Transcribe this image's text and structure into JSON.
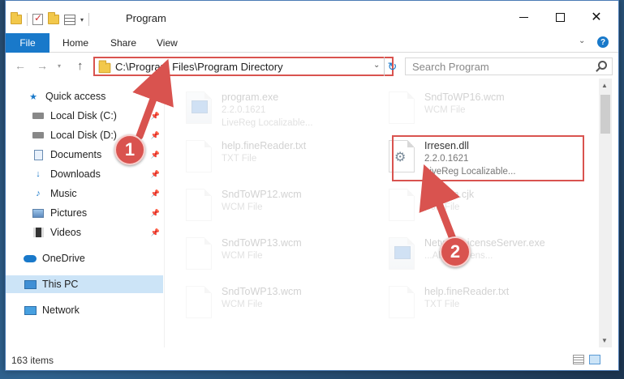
{
  "window": {
    "title": "Program",
    "controls": {
      "minimize": "",
      "maximize": "",
      "close": "✕"
    }
  },
  "ribbon": {
    "tabs": [
      "File",
      "Home",
      "Share",
      "View"
    ],
    "help": "?"
  },
  "navigation": {
    "back": "←",
    "forward": "→",
    "recent": "▾",
    "up": "↑",
    "address": "C:\\Program Files\\Program Directory",
    "refresh": "↻",
    "search_placeholder": "Search Program"
  },
  "sidebar": {
    "items": [
      {
        "label": "Quick access",
        "icon": "star-icon",
        "pinned": false
      },
      {
        "label": "Local Disk (C:)",
        "icon": "drive-icon",
        "pinned": true
      },
      {
        "label": "Local Disk (D:)",
        "icon": "drive-icon",
        "pinned": true
      },
      {
        "label": "Documents",
        "icon": "document-icon",
        "pinned": true
      },
      {
        "label": "Downloads",
        "icon": "download-icon",
        "pinned": true
      },
      {
        "label": "Music",
        "icon": "music-icon",
        "pinned": true
      },
      {
        "label": "Pictures",
        "icon": "pictures-icon",
        "pinned": true
      },
      {
        "label": "Videos",
        "icon": "videos-icon",
        "pinned": true
      },
      {
        "label": "OneDrive",
        "icon": "cloud-icon",
        "pinned": false
      },
      {
        "label": "This PC",
        "icon": "computer-icon",
        "pinned": false,
        "selected": true
      },
      {
        "label": "Network",
        "icon": "network-icon",
        "pinned": false
      }
    ]
  },
  "files": [
    {
      "name": "program.exe",
      "line1": "2.2.0.1621",
      "line2": "LiveReg Localizable...",
      "icon": "exe-icon"
    },
    {
      "name": "SndToWP16.wcm",
      "line1": "WCM File",
      "line2": "",
      "icon": "file-icon"
    },
    {
      "name": "help.fineReader.txt",
      "line1": "TXT File",
      "line2": "",
      "icon": "file-icon"
    },
    {
      "name": "Irresen.dll",
      "line1": "2.2.0.1621",
      "line2": "LiveReg Localizable...",
      "icon": "dll-gear-icon",
      "highlighted": true
    },
    {
      "name": "SndToWP12.wcm",
      "line1": "WCM File",
      "line2": "",
      "icon": "file-icon"
    },
    {
      "name": "...Xcom.cjk",
      "line1": "CJK File",
      "line2": "",
      "icon": "file-icon"
    },
    {
      "name": "SndToWP13.wcm",
      "line1": "WCM File",
      "line2": "",
      "icon": "file-icon"
    },
    {
      "name": "NetworkLicenseServer.exe",
      "line1": "...Abook licens...",
      "line2": "",
      "icon": "exe-icon"
    },
    {
      "name": "SndToWP13.wcm",
      "line1": "WCM File",
      "line2": "",
      "icon": "file-icon"
    },
    {
      "name": "help.fineReader.txt",
      "line1": "TXT File",
      "line2": "",
      "icon": "file-icon"
    }
  ],
  "status": {
    "items_count": "163 items"
  },
  "annotations": {
    "step1": "1",
    "step2": "2"
  },
  "colors": {
    "accent": "#1979ca",
    "annotation": "#d9534f"
  }
}
